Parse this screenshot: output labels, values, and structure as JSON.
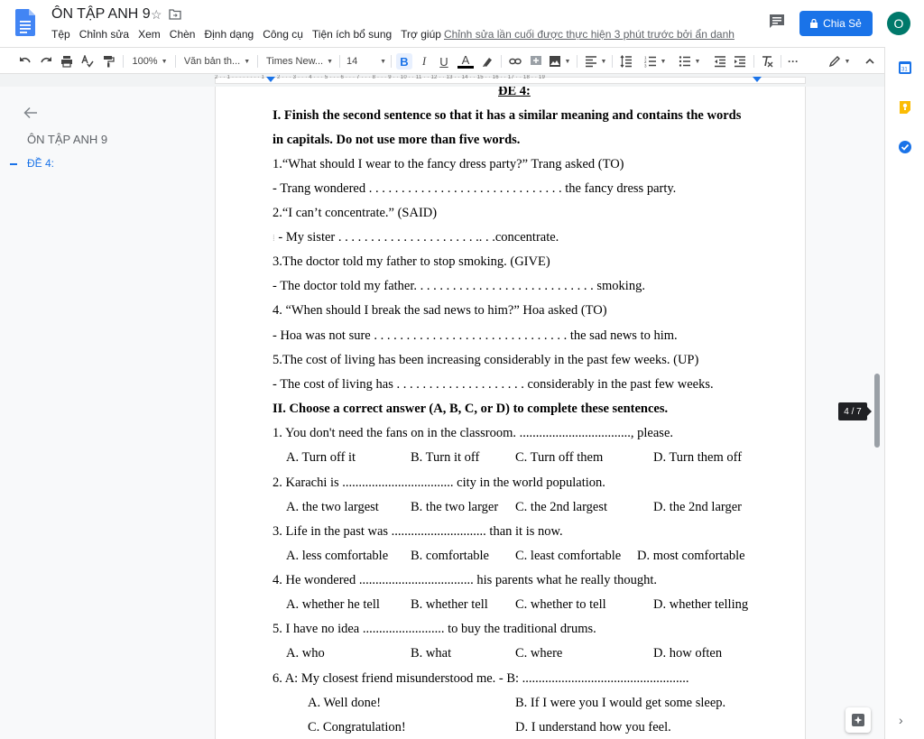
{
  "header": {
    "doc_title": "ÔN TẬP ANH 9",
    "menu": [
      "Tệp",
      "Chỉnh sửa",
      "Xem",
      "Chèn",
      "Định dạng",
      "Công cụ",
      "Tiện ích bổ sung",
      "Trợ giúp"
    ],
    "last_edit": "Chỉnh sửa lần cuối được thực hiện 3 phút trước bởi ẩn danh",
    "share_label": "Chia Sẻ",
    "avatar_initial": "O"
  },
  "toolbar": {
    "zoom": "100%",
    "style": "Văn bản th...",
    "font": "Times New...",
    "font_size": "14",
    "bold": "B",
    "italic": "I",
    "underline": "U",
    "text_color": "A",
    "more": "···"
  },
  "ruler": {
    "text": "2 · · 1 · · · · · · · · 1 · · · 2 · · · 3 · · · 4 · · · 5 · · · 6 · · · 7 · · · 8 · · · 9 · · 10 · · 11 · · 12 · · 13 · · 14 · · 15 · · 16 · · 17 · · 18 · · 19"
  },
  "outline": {
    "doc_title": "ÔN TẬP ANH 9",
    "items": [
      "ĐỀ 4:"
    ]
  },
  "page_indicator": "4 / 7",
  "document": {
    "heading": "ĐỀ 4:",
    "part1_title_1": "I. Finish the second sentence so that it has a similar meaning and contains the words",
    "part1_title_2": "in capitals. Do not use more than five words.",
    "q1": "1.“What should I wear to the fancy dress party?” Trang asked (TO)",
    "a1": "- Trang wondered  . . . . . . . . . . . . . . . . . . . . . . . . . . . . . . the fancy dress party.",
    "q2": "2.“I can’t concentrate.” (SAID)",
    "a2": "- My sister . . . . . . . . . . . . . . . . . . . . . .. . .concentrate.",
    "q3": "3.The doctor told my father to stop smoking. (GIVE)",
    "a3": "- The doctor told my father. . . . . . . . . . . . . . . . . . . . . . . . . . . . smoking.",
    "q4": "4. “When should I break the sad news to him?” Hoa asked (TO)",
    "a4": "- Hoa was not sure  . . . . . . . . . . . . . . . . . . . . . . . . . . . . . . the sad news to him.",
    "q5": "5.The cost of living has been increasing considerably in the past few weeks. (UP)",
    "a5": "- The cost of living has  . . . . . . . . . . . . . . . . . . . . considerably in the past few weeks.",
    "part2_title": "II. Choose a correct answer (A, B, C, or D) to complete these sentences.",
    "mc": [
      {
        "q": "1. You don't need the fans on in the classroom. .................................., please.",
        "opts": [
          "A. Turn off it",
          "B. Turn it off",
          "C. Turn off them",
          "D. Turn them off"
        ]
      },
      {
        "q": "2. Karachi is .................................. city in the world population.",
        "opts": [
          "A. the two largest",
          "B. the two larger",
          "C. the 2nd largest",
          "D. the 2nd larger"
        ]
      },
      {
        "q": "3. Life in the past was ............................. than it is now.",
        "opts": [
          "A. less comfortable",
          "B. comfortable",
          "C. least comfortable",
          "D. most comfortable"
        ]
      },
      {
        "q": "4. He wondered ................................... his parents what he really thought.",
        "opts": [
          "A. whether he tell",
          "B. whether tell",
          "C. whether to tell",
          "D. whether telling"
        ]
      },
      {
        "q": "5. I have no idea ......................... to buy the traditional drums.",
        "opts": [
          "A. who",
          "B. what",
          "C. where",
          "D. how often"
        ]
      }
    ],
    "q6": "6. A: My closest friend misunderstood me. - B:  ...................................................",
    "q6_opts": [
      "A. Well done!",
      "B. If I were you I would get some sleep.",
      "C. Congratulation!",
      "D. I understand how you feel."
    ]
  },
  "colors": {
    "accent": "#1a73e8",
    "avatar": "#00796b"
  }
}
